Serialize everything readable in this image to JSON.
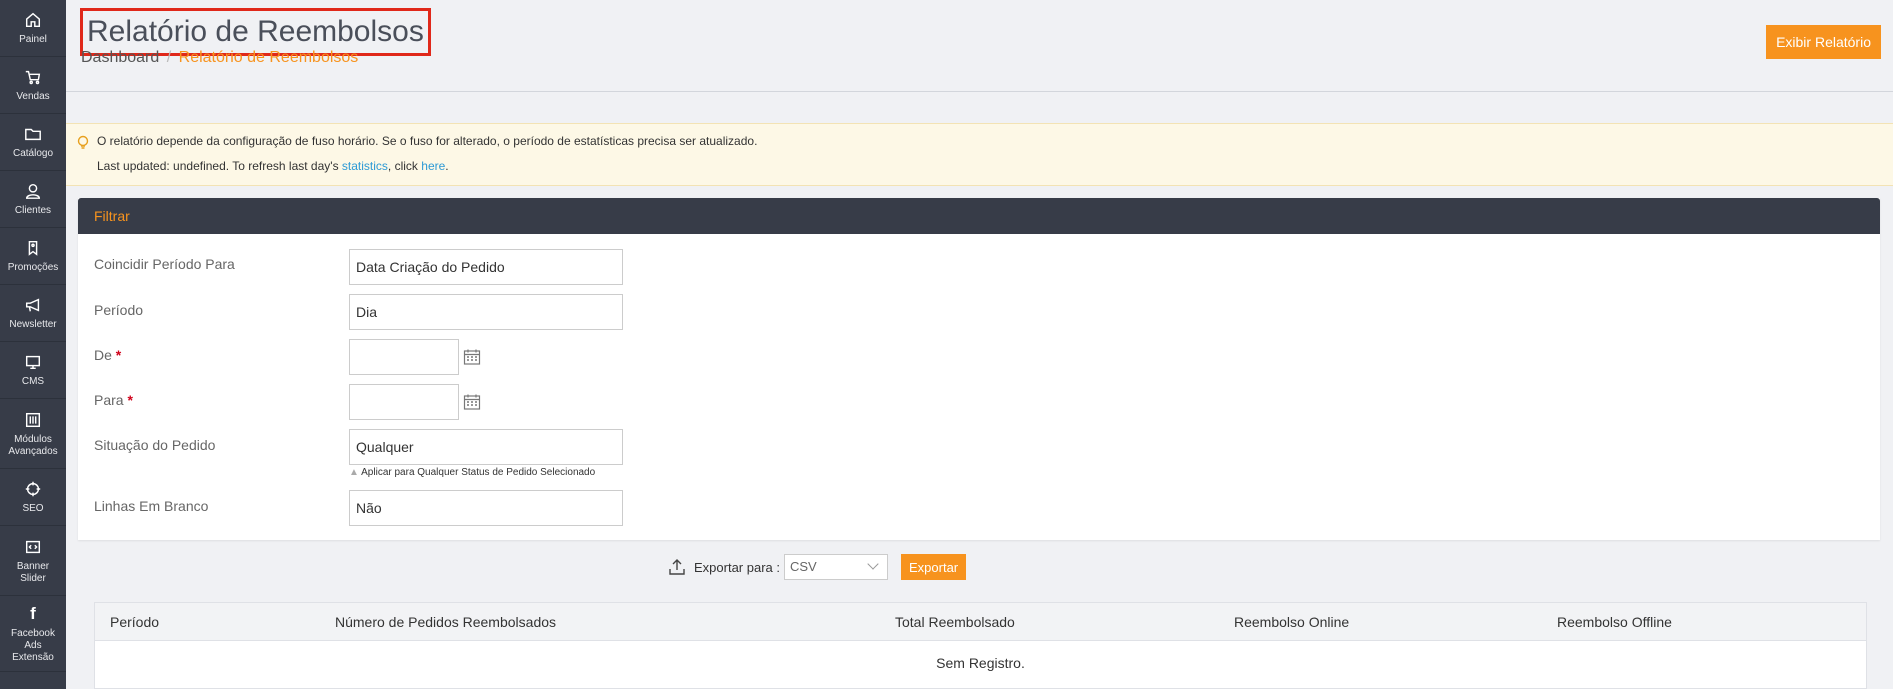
{
  "sidebar": {
    "items": [
      {
        "label": "Painel",
        "icon": "home-icon"
      },
      {
        "label": "Vendas",
        "icon": "cart-icon"
      },
      {
        "label": "Catálogo",
        "icon": "folder-icon"
      },
      {
        "label": "Clientes",
        "icon": "user-icon"
      },
      {
        "label": "Promoções",
        "icon": "tag-icon"
      },
      {
        "label": "Newsletter",
        "icon": "megaphone-icon"
      },
      {
        "label": "CMS",
        "icon": "monitor-icon"
      },
      {
        "label": "Módulos Avançados",
        "icon": "sliders-icon"
      },
      {
        "label": "SEO",
        "icon": "target-icon"
      },
      {
        "label": "Banner Slider",
        "icon": "code-icon"
      },
      {
        "label": "Facebook Ads Extensão",
        "icon": "facebook-icon"
      }
    ]
  },
  "header": {
    "title": "Relatório de Reembolsos",
    "breadcrumb": {
      "root": "Dashboard",
      "separator": "/",
      "current": "Relatório de Reembolsos"
    },
    "show_report_label": "Exibir Relatório"
  },
  "notice": {
    "line1": "O relatório depende da configuração de fuso horário. Se o fuso for alterado, o período de estatísticas precisa ser atualizado.",
    "line2_prefix": "Last updated: undefined. To refresh last day's ",
    "line2_link1": "statistics",
    "line2_middle": ", click ",
    "line2_link2": "here",
    "line2_suffix": "."
  },
  "filter": {
    "title": "Filtrar",
    "match_period_label": "Coincidir Período Para",
    "match_period_value": "Data Criação do Pedido",
    "period_label": "Período",
    "period_value": "Dia",
    "from_label": "De",
    "to_label": "Para",
    "required_mark": "*",
    "order_status_label": "Situação do Pedido",
    "order_status_value": "Qualquer",
    "order_status_hint": "Aplicar para Qualquer Status de Pedido Selecionado",
    "empty_rows_label": "Linhas Em Branco",
    "empty_rows_value": "Não"
  },
  "export": {
    "label": "Exportar para :",
    "format": "CSV",
    "button": "Exportar"
  },
  "table": {
    "columns": [
      "Período",
      "Número de Pedidos Reembolsados",
      "Total Reembolsado",
      "Reembolso Online",
      "Reembolso Offline"
    ],
    "empty_text": "Sem Registro."
  },
  "colors": {
    "accent": "#f7931e",
    "sidebar": "#373c48",
    "link": "#2d9ad5"
  }
}
